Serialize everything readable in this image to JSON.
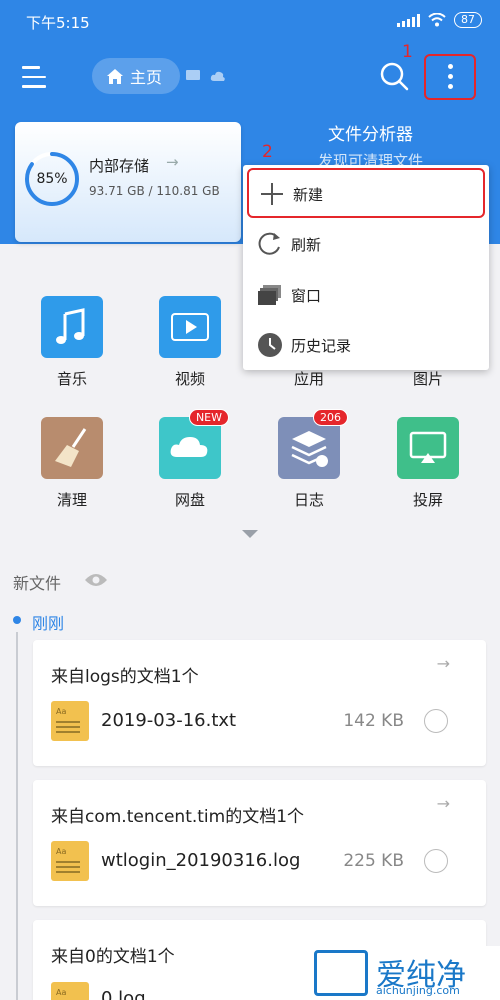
{
  "status_bar": {
    "time": "下午5:15",
    "battery": "87"
  },
  "toolbar": {
    "home_label": "主页"
  },
  "annotations": {
    "first": "1",
    "second": "2"
  },
  "storage": {
    "percent": "85%",
    "percent_value": 0.85,
    "title": "内部存储",
    "arrow": "→",
    "usage": "93.71 GB / 110.81 GB"
  },
  "analyzer": {
    "title": "文件分析器",
    "subtitle": "发现可清理文件"
  },
  "menu": {
    "items": [
      {
        "label": "新建",
        "icon": "plus-icon"
      },
      {
        "label": "刷新",
        "icon": "refresh-icon"
      },
      {
        "label": "窗口",
        "icon": "windows-icon"
      },
      {
        "label": "历史记录",
        "icon": "history-icon"
      }
    ]
  },
  "grid": {
    "items": [
      {
        "label": "音乐",
        "icon": "music-icon",
        "color": "#2f9bea"
      },
      {
        "label": "视频",
        "icon": "video-icon",
        "color": "#2f9bea"
      },
      {
        "label": "应用",
        "icon": "android-icon",
        "color": "#5bbf6b"
      },
      {
        "label": "图片",
        "icon": "image-icon",
        "color": "#f2a33a"
      },
      {
        "label": "清理",
        "icon": "broom-icon",
        "color": "#b88c6e"
      },
      {
        "label": "网盘",
        "icon": "cloud-icon",
        "color": "#3ec6c9",
        "badge": "NEW"
      },
      {
        "label": "日志",
        "icon": "log-icon",
        "color": "#7e8fb8",
        "badge": "206"
      },
      {
        "label": "投屏",
        "icon": "cast-icon",
        "color": "#3fbf8a"
      }
    ]
  },
  "new_files": {
    "label": "新文件",
    "group_label": "刚刚"
  },
  "file_cards": [
    {
      "title": "来自logs的文档1个",
      "file": "2019-03-16.txt",
      "size": "142 KB"
    },
    {
      "title": "来自com.tencent.tim的文档1个",
      "file": "wtlogin_20190316.log",
      "size": "225 KB"
    },
    {
      "title": "来自0的文档1个",
      "file": "0.log",
      "size": ""
    }
  ],
  "watermark": {
    "text": "爱纯净",
    "url": "aichunjing.com"
  },
  "colors": {
    "primary": "#2f86e6",
    "highlight": "#e5262b",
    "background": "#f2f2f5"
  }
}
